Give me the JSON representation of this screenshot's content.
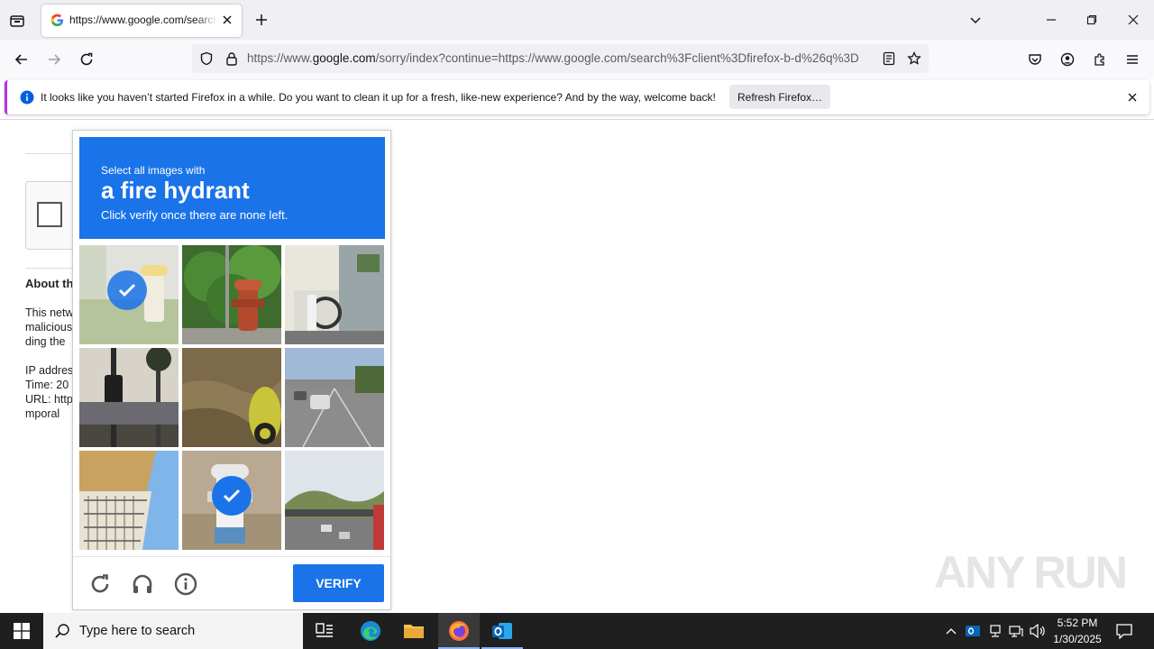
{
  "browser": {
    "tab_title": "https://www.google.com/search?client=firefox-b-d&q",
    "url_host_prefix": "https://www.",
    "url_host": "google.com",
    "url_rest": "/sorry/index?continue=https://www.google.com/search%3Fclient%3Dfirefox-b-d%26q%3D"
  },
  "notification": {
    "message": "It looks like you haven’t started Firefox in a while. Do you want to clean it up for a fresh, like-new experience? And by the way, welcome back!",
    "button_label": "Refresh Firefox…"
  },
  "page": {
    "about_heading": "About th",
    "line1": "This netw",
    "line2": "malicious",
    "line3": "ding the",
    "ip_label": "IP addres",
    "time_label": "Time: 20",
    "url_label": "URL: http",
    "line_mporal": "mporal"
  },
  "captcha": {
    "instruction_small": "Select all images with",
    "target_object": "a fire hydrant",
    "instruction_sub": "Click verify once there are none left.",
    "verify_label": "VERIFY",
    "accent_color": "#1a73e8",
    "tiles": [
      {
        "content": "fire hydrant (yellow top)",
        "selected": true
      },
      {
        "content": "red fire hydrant by bush",
        "selected": false
      },
      {
        "content": "building with bikes",
        "selected": false
      },
      {
        "content": "traffic light and palm trees",
        "selected": false
      },
      {
        "content": "grass with scooter",
        "selected": false
      },
      {
        "content": "road with cars",
        "selected": false
      },
      {
        "content": "building balcony",
        "selected": false
      },
      {
        "content": "white fire hydrant",
        "selected": true
      },
      {
        "content": "highway with hills",
        "selected": false
      }
    ]
  },
  "taskbar": {
    "search_placeholder": "Type here to search",
    "time": "5:52 PM",
    "date": "1/30/2025"
  },
  "watermark": "ANY RUN"
}
